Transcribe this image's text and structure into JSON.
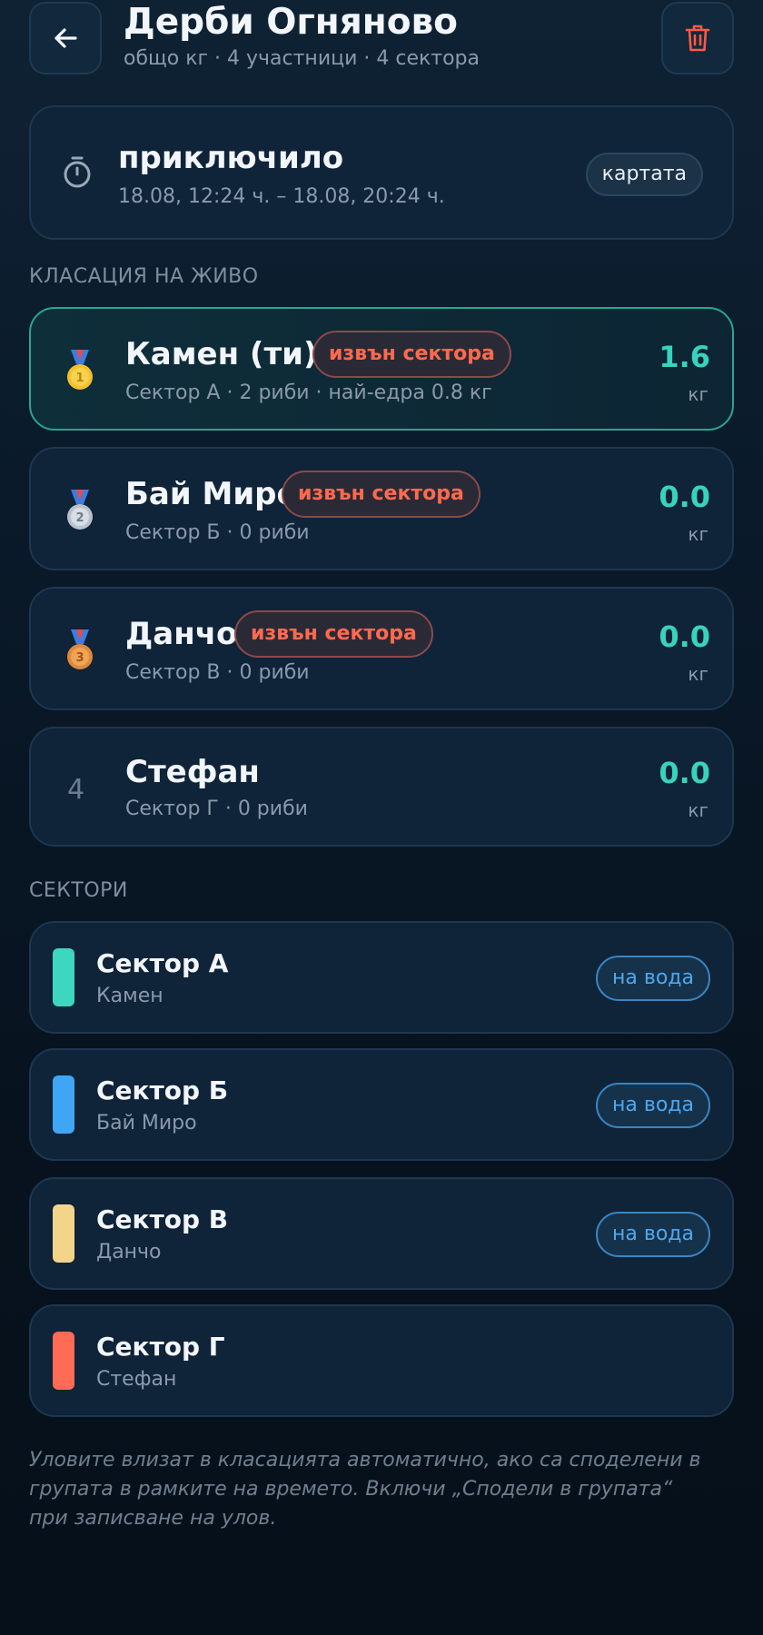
{
  "header": {
    "title": "Дерби Огняново",
    "subtitle": "общо кг · 4 участници · 4 сектора"
  },
  "status": {
    "title": "приключило",
    "time_range": "18.08, 12:24 ч. – 18.08, 20:24 ч.",
    "map_label": "картата"
  },
  "leaderboard": {
    "label": "КЛАСАЦИЯ НА ЖИВО",
    "entries": [
      {
        "rank": "1",
        "medal": "gold-medal-icon",
        "name": "Камен (ти)",
        "badge": "извън сектора",
        "detail": "Сектор А · 2 риби · най-едра 0.8 кг",
        "score": "1.6",
        "unit": "кг"
      },
      {
        "rank": "2",
        "medal": "silver-medal-icon",
        "name": "Бай Миро",
        "badge": "извън сектора",
        "detail": "Сектор Б · 0 риби",
        "score": "0.0",
        "unit": "кг"
      },
      {
        "rank": "3",
        "medal": "bronze-medal-icon",
        "name": "Данчо",
        "badge": "извън сектора",
        "detail": "Сектор В · 0 риби",
        "score": "0.0",
        "unit": "кг"
      },
      {
        "rank": "4",
        "medal": "",
        "name": "Стефан",
        "badge": "",
        "detail": "Сектор Г · 0 риби",
        "score": "0.0",
        "unit": "кг"
      }
    ]
  },
  "sectors": {
    "label": "СЕКТОРИ",
    "items": [
      {
        "name": "Сектор А",
        "person": "Камен",
        "color": "#3dd6c0",
        "status": "на вода"
      },
      {
        "name": "Сектор Б",
        "person": "Бай Миро",
        "color": "#3fa6f5",
        "status": "на вода"
      },
      {
        "name": "Сектор В",
        "person": "Данчо",
        "color": "#f3d58a",
        "status": "на вода"
      },
      {
        "name": "Сектор Г",
        "person": "Стефан",
        "color": "#ff6b55",
        "status": ""
      }
    ]
  },
  "footnote": "Уловите влизат в класацията автоматично, ако са споделени в групата в рамките на времето. Включи „Сподели в групата“ при записване на улов."
}
